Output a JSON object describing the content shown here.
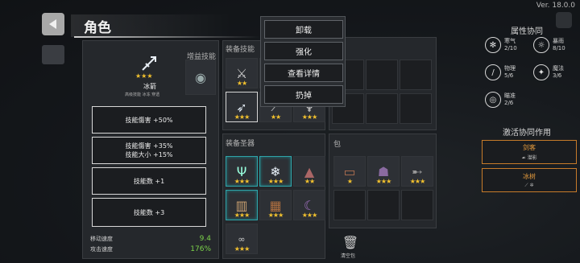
{
  "version": "Ver. 18.0.0",
  "header": {
    "title": "角色"
  },
  "character_card": {
    "name": "冰箭",
    "tags": "高级技能  冰冻  穿透",
    "stars": "★★★",
    "side_label": "增益技能"
  },
  "skill_buttons": [
    {
      "line1": "技能傷害 +50%",
      "line2": ""
    },
    {
      "line1": "技能傷害 +35%",
      "line2": "技能大小 +15%"
    },
    {
      "line1": "技能数 +1",
      "line2": ""
    },
    {
      "line1": "技能数 +3",
      "line2": ""
    }
  ],
  "stats": [
    {
      "label": "移动速度",
      "value": "9.4"
    },
    {
      "label": "攻击速度",
      "value": "176%"
    }
  ],
  "equip_skills": {
    "label": "装备技能",
    "slots": [
      {
        "icon": "sword-icon",
        "stars": "★★"
      },
      {
        "icon": "empty",
        "stars": ""
      },
      {
        "icon": "empty",
        "stars": ""
      },
      {
        "icon": "empty",
        "stars": ""
      },
      {
        "icon": "ice-arrow-icon",
        "stars": "★★★"
      },
      {
        "icon": "blade-icon",
        "stars": "★★"
      },
      {
        "icon": "wing-icon",
        "stars": "★★★"
      },
      {
        "icon": "empty",
        "stars": ""
      }
    ]
  },
  "context_menu": {
    "items": [
      "卸载",
      "强化",
      "查看详情",
      "扔掉"
    ]
  },
  "equip_relics": {
    "label": "装备圣器",
    "slots": [
      {
        "icon": "antler-icon",
        "stars": "★★★",
        "teal": true
      },
      {
        "icon": "snowflake-icon",
        "stars": "★★★",
        "teal": true
      },
      {
        "icon": "hat-icon",
        "stars": "★★",
        "teal": false
      },
      {
        "icon": "barrel-icon",
        "stars": "★★★",
        "teal": true
      },
      {
        "icon": "crate-icon",
        "stars": "★★★",
        "teal": false
      },
      {
        "icon": "horn-icon",
        "stars": "★★★",
        "teal": false
      },
      {
        "icon": "chain-icon",
        "stars": "★★★",
        "teal": false
      }
    ]
  },
  "bag": {
    "label": "包",
    "slots": [
      {
        "icon": "scroll-icon",
        "stars": "★"
      },
      {
        "icon": "beast-icon",
        "stars": "★★★"
      },
      {
        "icon": "blade-icon",
        "stars": "★★★"
      },
      {
        "icon": "empty",
        "stars": ""
      },
      {
        "icon": "empty",
        "stars": ""
      },
      {
        "icon": "empty",
        "stars": ""
      },
      {
        "icon": "empty",
        "stars": ""
      },
      {
        "icon": "empty",
        "stars": ""
      }
    ],
    "clear_label": "清空包"
  },
  "attributes": {
    "title": "属性协同",
    "items": [
      {
        "name": "寒气",
        "value": "2/10",
        "glyph": "✻"
      },
      {
        "name": "暴雨",
        "value": "8/10",
        "glyph": "☼"
      },
      {
        "name": "物理",
        "value": "5/6",
        "glyph": "/"
      },
      {
        "name": "魔法",
        "value": "3/6",
        "glyph": "✦"
      },
      {
        "name": "瞄准",
        "value": "2/6",
        "glyph": "◎"
      }
    ]
  },
  "active_synergy": {
    "title": "激活协同作用",
    "items": [
      {
        "name": "剑客",
        "sub": "☙  潜影"
      },
      {
        "name": "冰树",
        "sub": "⟋   ✲"
      }
    ]
  },
  "colors": {
    "star": "#f2c12e",
    "accent_orange": "#c77b2a",
    "stat_green": "#7bd24a",
    "teal": "#2fa3a8"
  }
}
